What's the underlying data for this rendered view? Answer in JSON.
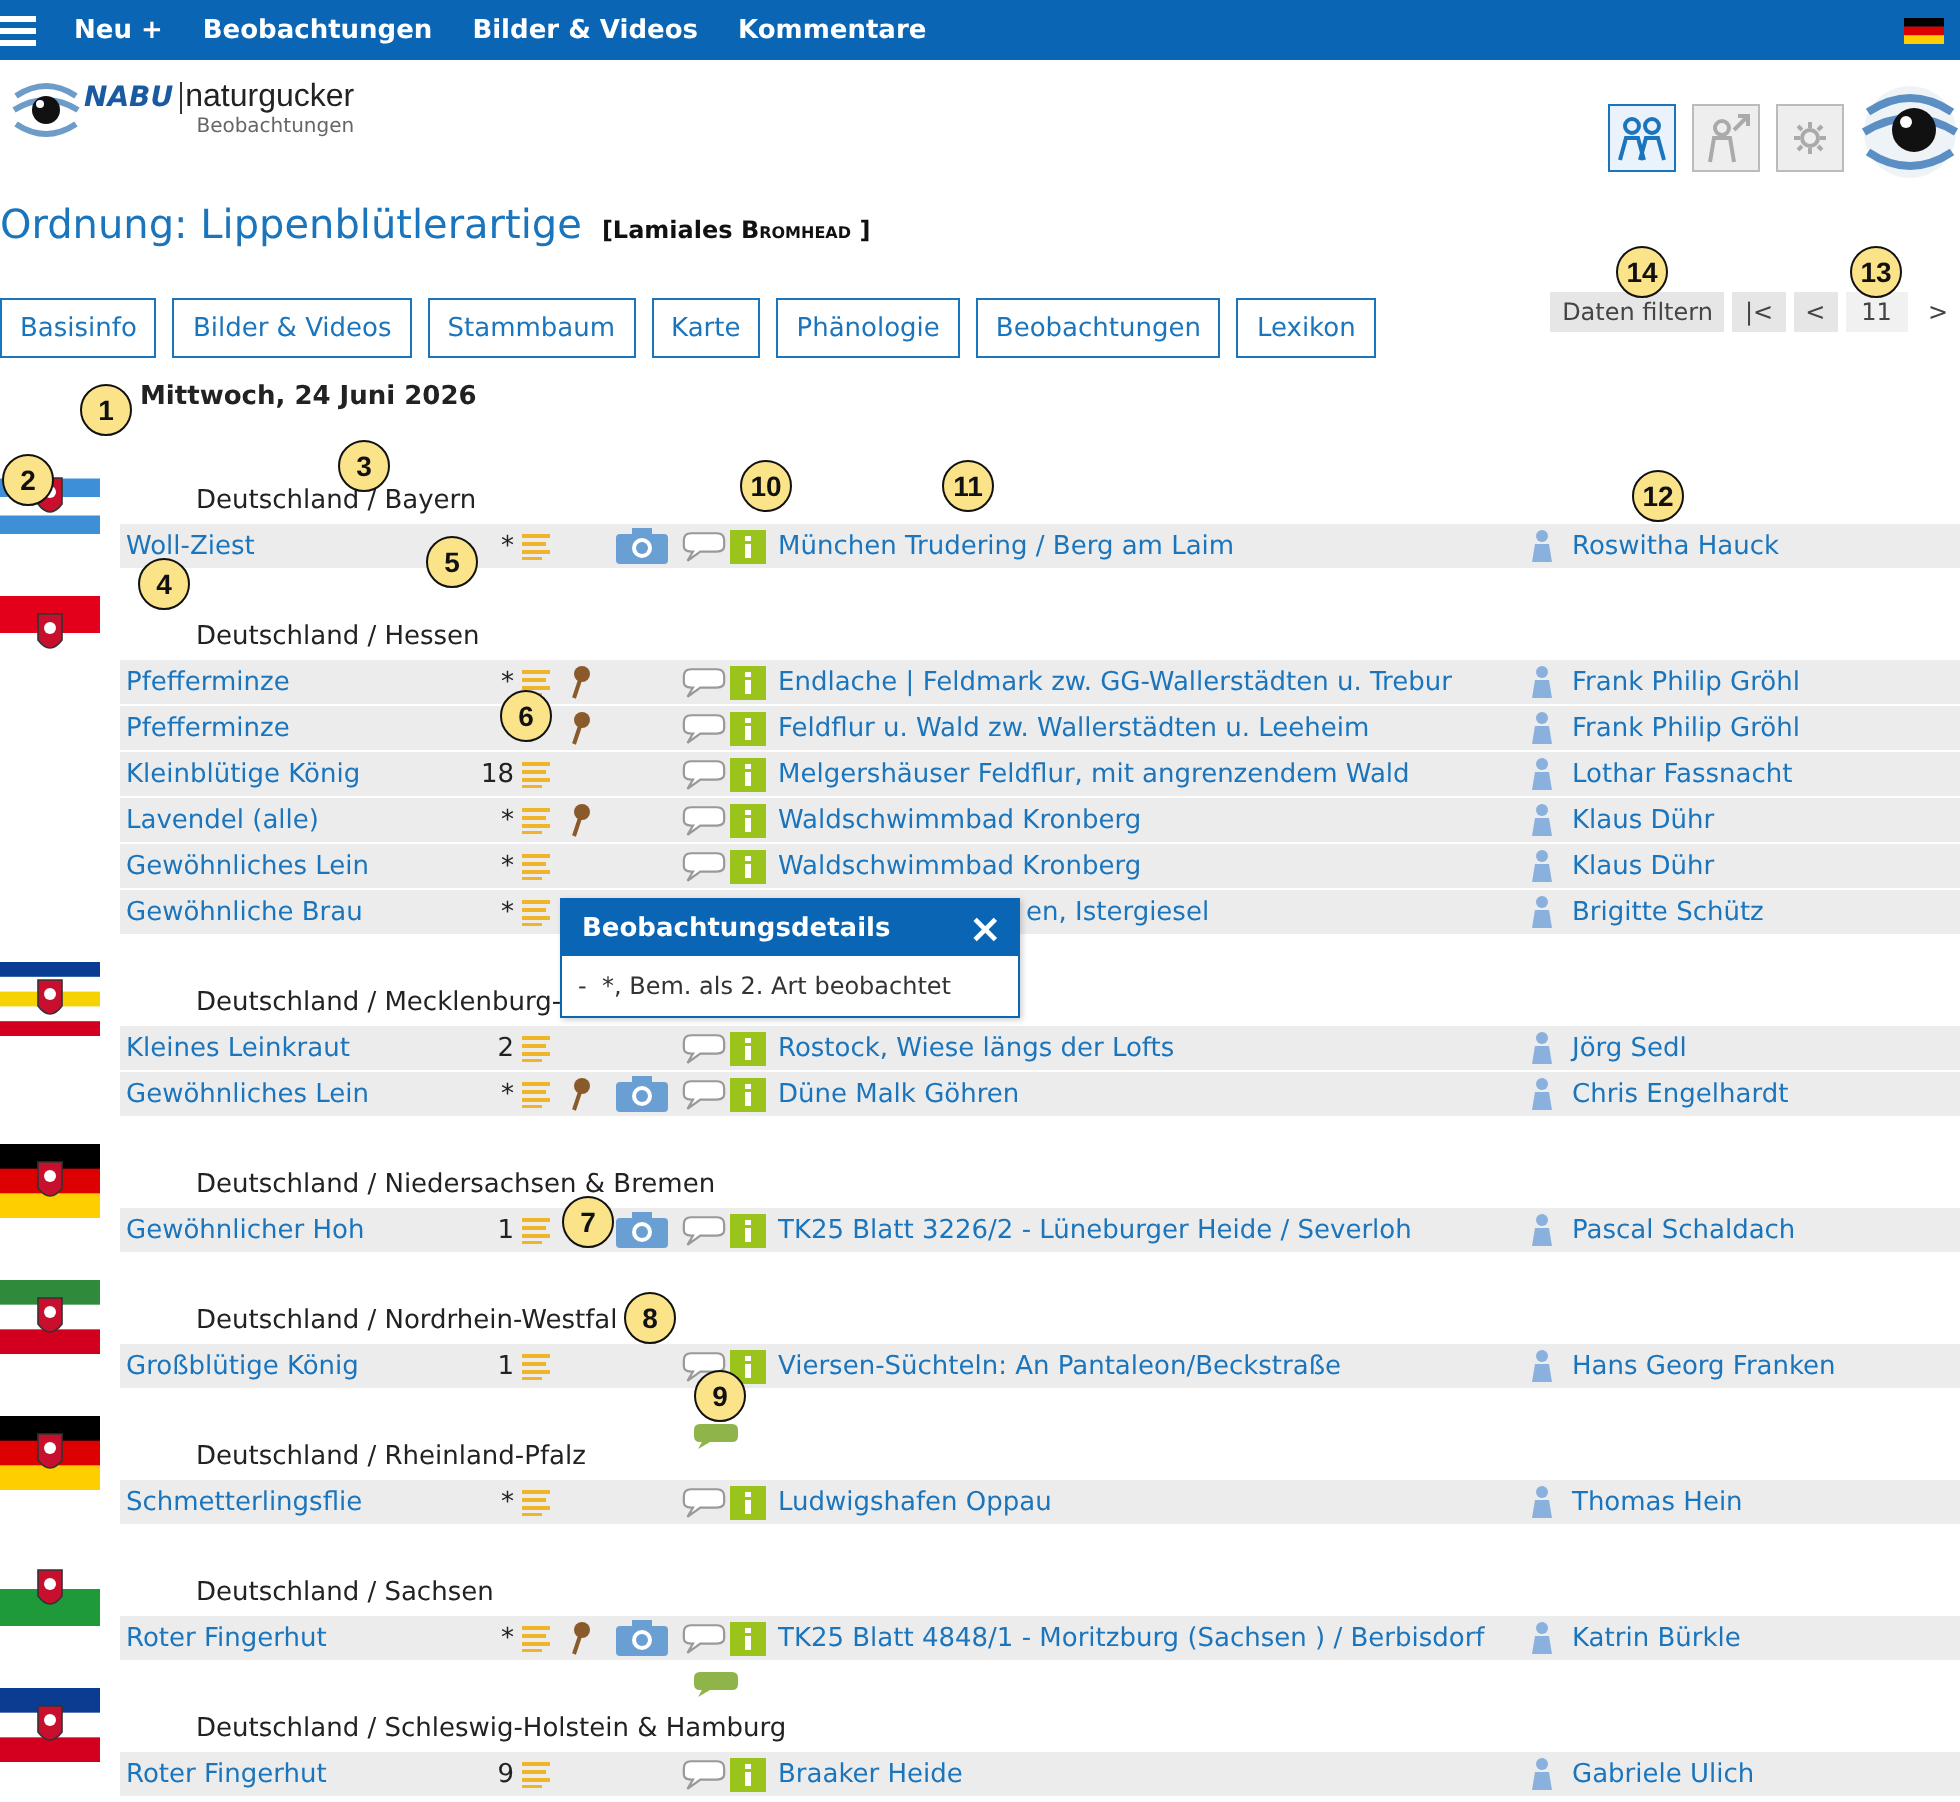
{
  "topbar": {
    "menu": [
      "Neu +",
      "Beobachtungen",
      "Bilder & Videos",
      "Kommentare"
    ]
  },
  "logo": {
    "brand": "NABU",
    "name": "naturgucker",
    "subtitle": "Beobachtungen"
  },
  "title": {
    "text": "Ordnung: Lippenblütlerartige",
    "taxon": "[Lamiales",
    "author": "Bromhead",
    "close": "]"
  },
  "tabs": [
    "Basisinfo",
    "Bilder & Videos",
    "Stammbaum",
    "Karte",
    "Phänologie",
    "Beobachtungen",
    "Lexikon"
  ],
  "pager": {
    "filter": "Daten filtern",
    "first": "|<",
    "prev": "<",
    "page": "11",
    "next": ">"
  },
  "date": "Mittwoch, 24 Juni 2026",
  "regions": [
    {
      "name": "Deutschland / Bayern",
      "comment": false,
      "rows": [
        {
          "species": "Woll-Ziest",
          "count": "*",
          "pin": false,
          "photo": true,
          "covered": false,
          "location": "München Trudering / Berg am Laim",
          "observer": "Roswitha Hauck"
        }
      ]
    },
    {
      "name": "Deutschland / Hessen",
      "comment": false,
      "rows": [
        {
          "species": "Pfefferminze",
          "count": "*",
          "pin": true,
          "photo": false,
          "covered": false,
          "location": "Endlache | Feldmark zw. GG-Wallerstädten u. Trebur",
          "observer": "Frank Philip Gröhl"
        },
        {
          "species": "Pfefferminze",
          "notes": false,
          "pin": true,
          "photo": false,
          "covered": false,
          "location": "Feldflur u. Wald zw. Wallerstädten u. Leeheim",
          "observer": "Frank Philip Gröhl"
        },
        {
          "species": "Kleinblütige König",
          "count": "18",
          "pin": false,
          "photo": false,
          "covered": false,
          "location": "Melgershäuser Feldflur, mit angrenzendem Wald",
          "observer": "Lothar Fassnacht"
        },
        {
          "species": "Lavendel (alle)",
          "count": "*",
          "pin": true,
          "photo": false,
          "covered": false,
          "location": "Waldschwimmbad Kronberg",
          "observer": "Klaus Dühr"
        },
        {
          "species": "Gewöhnliches Lein",
          "count": "*",
          "pin": false,
          "photo": false,
          "covered": false,
          "location": "Waldschwimmbad Kronberg",
          "observer": "Klaus Dühr"
        },
        {
          "species": "Gewöhnliche Brau",
          "count": "*",
          "pin": false,
          "photo": false,
          "covered": true,
          "location": "en, Istergiesel",
          "observer": "Brigitte Schütz"
        }
      ]
    },
    {
      "name": "Deutschland / Mecklenburg-",
      "comment": false,
      "rows": [
        {
          "species": "Kleines Leinkraut",
          "count": "2",
          "pin": false,
          "photo": false,
          "covered": false,
          "location": "Rostock, Wiese längs der Lofts",
          "observer": "Jörg Sedl"
        },
        {
          "species": "Gewöhnliches Lein",
          "count": "*",
          "pin": true,
          "photo": true,
          "covered": false,
          "location": "Düne Malk Göhren",
          "observer": "Chris Engelhardt"
        }
      ]
    },
    {
      "name": "Deutschland / Niedersachsen & Bremen",
      "comment": false,
      "rows": [
        {
          "species": "Gewöhnlicher Hoh",
          "count": "1",
          "photo": true,
          "covered": false,
          "location": "TK25 Blatt 3226/2 - Lüneburger Heide / Severloh",
          "observer": "Pascal Schaldach"
        }
      ]
    },
    {
      "name": "Deutschland / Nordrhein-Westfal",
      "comment": false,
      "rows": [
        {
          "species": "Großblütige König",
          "count": "1",
          "pin": false,
          "photo": false,
          "covered": false,
          "location": "Viersen-Süchteln: An Pantaleon/Beckstraße",
          "observer": "Hans Georg Franken"
        }
      ]
    },
    {
      "name": "Deutschland / Rheinland-Pfalz",
      "comment": true,
      "rows": [
        {
          "species": "Schmetterlingsflie",
          "count": "*",
          "pin": false,
          "photo": false,
          "covered": false,
          "location": "Ludwigshafen Oppau",
          "observer": "Thomas Hein"
        }
      ]
    },
    {
      "name": "Deutschland / Sachsen",
      "comment": false,
      "rows": [
        {
          "species": "Roter Fingerhut",
          "count": "*",
          "pin": true,
          "photo": true,
          "covered": false,
          "comment_below": true,
          "location": "TK25 Blatt 4848/1 - Moritzburg (Sachsen ) / Berbisdorf",
          "observer": "Katrin Bürkle"
        }
      ]
    },
    {
      "name": "Deutschland / Schleswig-Holstein & Hamburg",
      "comment": false,
      "rows": [
        {
          "species": "Roter Fingerhut",
          "count": "9",
          "pin": false,
          "photo": false,
          "covered": false,
          "location": "Braaker Heide",
          "observer": "Gabriele Ulich"
        }
      ]
    }
  ],
  "popup": {
    "title": "Beobachtungsdetails",
    "close": "×",
    "text": "-  *, Bem. als 2. Art beobachtet"
  },
  "callouts": [
    "1",
    "2",
    "3",
    "4",
    "5",
    "6",
    "7",
    "8",
    "9",
    "10",
    "11",
    "12",
    "13",
    "14"
  ]
}
